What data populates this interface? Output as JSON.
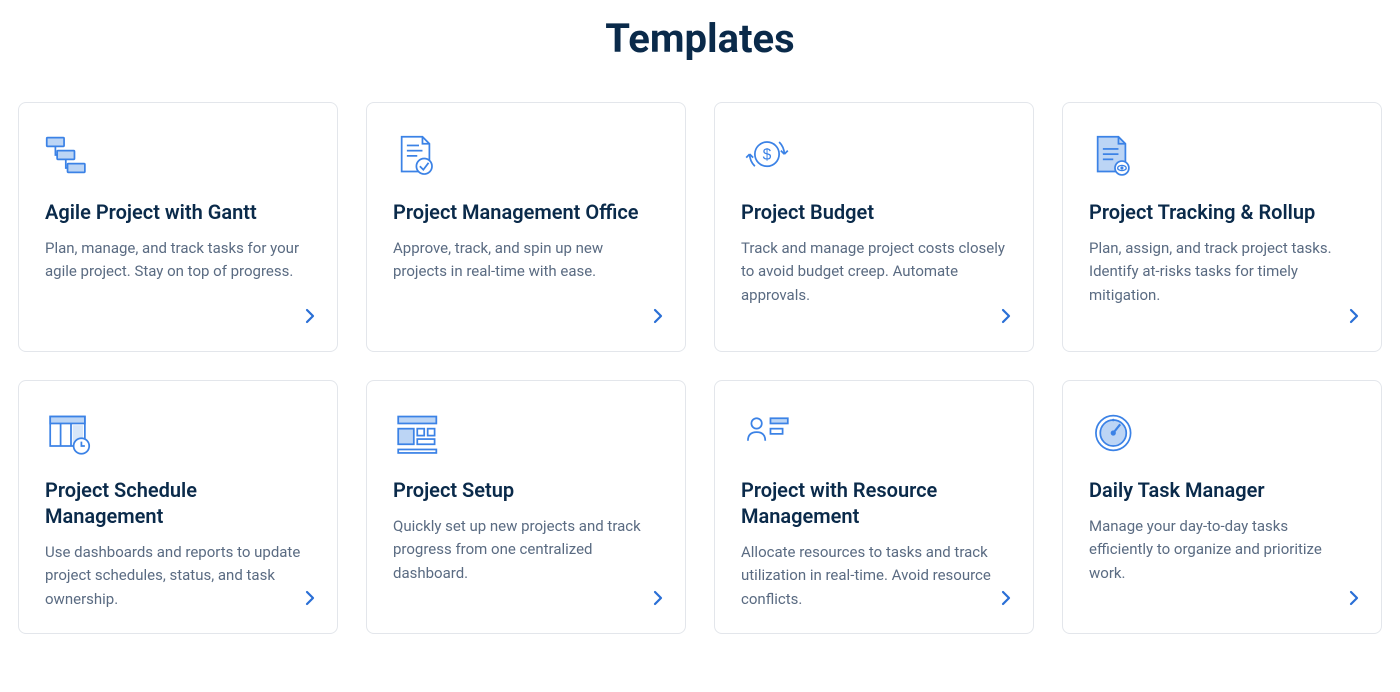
{
  "title": "Templates",
  "icon_stroke": "#3b82e6",
  "icon_fill": "#bcd5f5",
  "cards": [
    {
      "icon": "gantt",
      "title": "Agile Project with Gantt",
      "desc": "Plan, manage, and track tasks for your agile project. Stay on top of progress."
    },
    {
      "icon": "doc-check",
      "title": "Project Management Office",
      "desc": "Approve, track, and spin up new projects in real-time with ease."
    },
    {
      "icon": "budget",
      "title": "Project Budget",
      "desc": "Track and manage project costs closely to avoid budget creep. Automate approvals."
    },
    {
      "icon": "doc-eye",
      "title": "Project Tracking & Rollup",
      "desc": "Plan, assign, and track project tasks. Identify at-risks tasks for timely mitigation."
    },
    {
      "icon": "schedule",
      "title": "Project Schedule Management",
      "desc": "Use dashboards and reports to update project schedules, status, and task ownership."
    },
    {
      "icon": "setup",
      "title": "Project Setup",
      "desc": "Quickly set up new projects and track progress from one centralized dashboard."
    },
    {
      "icon": "resource",
      "title": "Project with Resource Management",
      "desc": "Allocate resources to tasks and track utilization in real-time. Avoid resource conflicts."
    },
    {
      "icon": "gauge",
      "title": "Daily Task Manager",
      "desc": "Manage your day-to-day tasks efficiently to organize and prioritize work."
    }
  ]
}
